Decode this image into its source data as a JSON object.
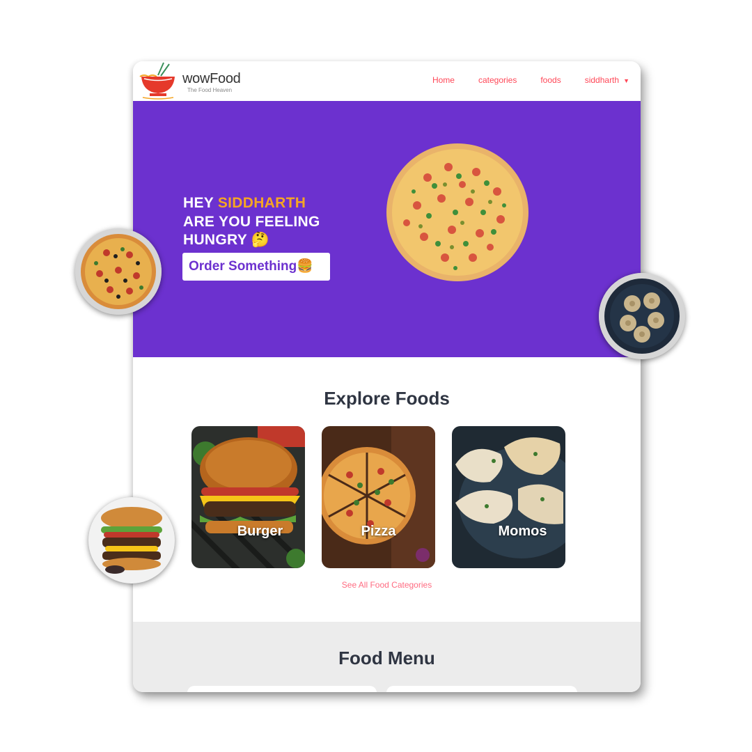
{
  "navbar": {
    "brand": "wowFood",
    "tagline": "The Food Heaven",
    "links": [
      "Home",
      "categories",
      "foods"
    ],
    "user": "siddharth",
    "user_caret": "▼",
    "logo_icon": "noodle-bowl-icon"
  },
  "hero": {
    "greeting": "HEY",
    "name": "SIDDHARTH",
    "line2": "ARE YOU FEELING",
    "line3": "HUNGRY",
    "emoji": "🤔",
    "button_label": "Order Something",
    "button_emoji": "🍔",
    "background_color": "#6c31cf",
    "accent_color": "#f5a524"
  },
  "explore": {
    "title": "Explore Foods",
    "categories": [
      {
        "label": "Burger"
      },
      {
        "label": "Pizza"
      },
      {
        "label": "Momos"
      }
    ],
    "see_all": "See All Food Categories"
  },
  "menu": {
    "title": "Food Menu"
  },
  "colors": {
    "link": "#ff4757",
    "heading": "#2f3542"
  }
}
